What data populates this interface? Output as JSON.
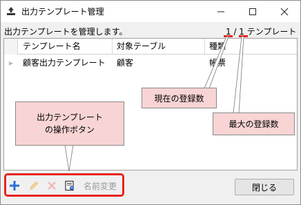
{
  "window": {
    "title": "出力テンプレート管理",
    "icons": {
      "app": "upload-icon",
      "minimize": "minimize-icon",
      "maximize": "maximize-icon",
      "close": "close-icon"
    }
  },
  "header": {
    "description": "出力テンプレートを管理します。",
    "count": "1 / 1 テンプレート"
  },
  "table": {
    "columns": [
      "テンプレート名",
      "対象テーブル",
      "種類"
    ],
    "rows": [
      [
        "顧客出力テンプレート",
        "顧客",
        "帳票"
      ]
    ]
  },
  "toolbar": {
    "add_icon": "plus-icon",
    "edit_icon": "pencil-icon",
    "delete_icon": "x-icon",
    "doc_icon": "document-icon",
    "rename_label": "名前変更"
  },
  "footer": {
    "close_label": "閉じる"
  },
  "annotations": {
    "current_count": "現在の登録数",
    "max_count": "最大の登録数",
    "ops_line1": "出力テンプレート",
    "ops_line2": "の操作ボタン"
  },
  "colors": {
    "accent_red": "#e8231f",
    "callout_fill": "#f8d4d4",
    "add_blue": "#2b6fd6"
  }
}
